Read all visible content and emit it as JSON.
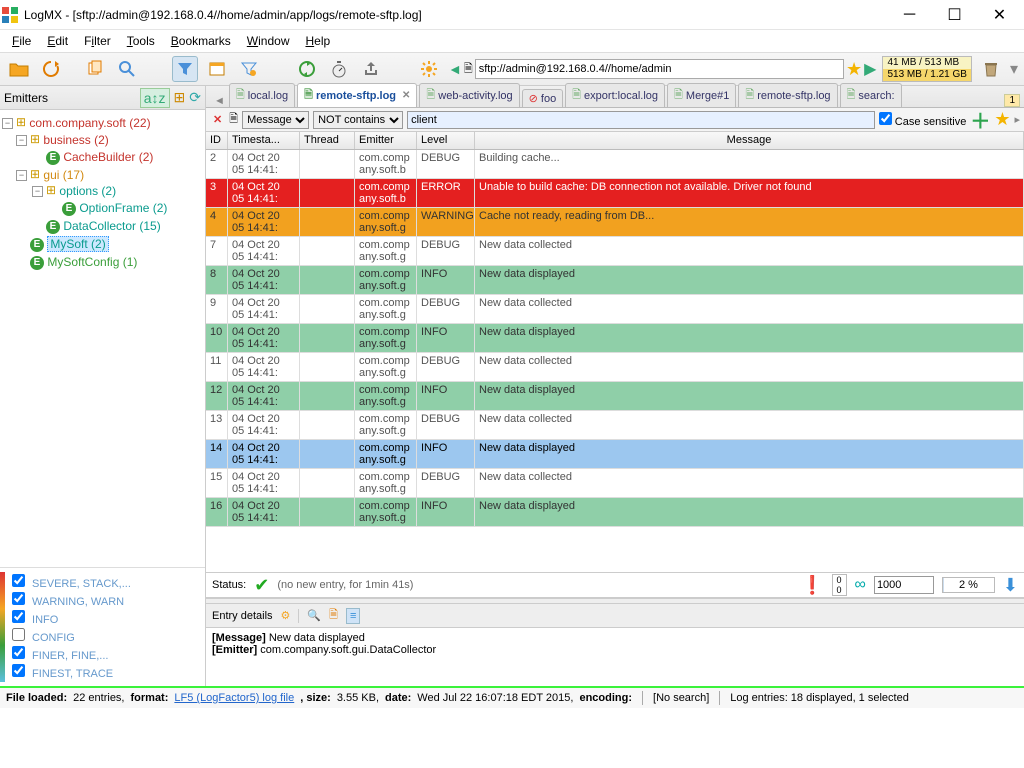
{
  "title": "LogMX - [sftp://admin@192.168.0.4//home/admin/app/logs/remote-sftp.log]",
  "menu": {
    "file": "File",
    "edit": "Edit",
    "filter": "Filter",
    "tools": "Tools",
    "bookmarks": "Bookmarks",
    "window": "Window",
    "help": "Help"
  },
  "addressbar": {
    "value": "sftp://admin@192.168.0.4//home/admin"
  },
  "memory": {
    "line1": "41 MB / 513 MB",
    "line2": "513 MB / 1.21 GB"
  },
  "emitters": {
    "title": "Emitters",
    "nodes": [
      {
        "label": "com.company.soft (22)",
        "color": "red",
        "depth": 0,
        "open": true,
        "pkg": true
      },
      {
        "label": "business (2)",
        "color": "red",
        "depth": 1,
        "open": true,
        "pkg": true
      },
      {
        "label": "CacheBuilder (2)",
        "color": "red",
        "depth": 2,
        "cls": "E"
      },
      {
        "label": "gui (17)",
        "color": "orange",
        "depth": 1,
        "open": true,
        "pkg": true
      },
      {
        "label": "options (2)",
        "color": "teal",
        "depth": 2,
        "open": true,
        "pkg": true
      },
      {
        "label": "OptionFrame (2)",
        "color": "teal",
        "depth": 3,
        "cls": "E"
      },
      {
        "label": "DataCollector (15)",
        "color": "teal",
        "depth": 2,
        "cls": "E"
      },
      {
        "label": "MySoft (2)",
        "color": "teal",
        "depth": 1,
        "cls": "E",
        "selected": true
      },
      {
        "label": "MySoftConfig (1)",
        "color": "green",
        "depth": 1,
        "cls": "E"
      }
    ]
  },
  "levelFilter": [
    {
      "label": "SEVERE, STACK,...",
      "checked": true
    },
    {
      "label": "WARNING, WARN",
      "checked": true
    },
    {
      "label": "INFO",
      "checked": true
    },
    {
      "label": "CONFIG",
      "checked": false
    },
    {
      "label": "FINER, FINE,...",
      "checked": true
    },
    {
      "label": "FINEST, TRACE",
      "checked": true
    }
  ],
  "tabs": [
    {
      "label": "local.log"
    },
    {
      "label": "remote-sftp.log",
      "active": true,
      "closable": true
    },
    {
      "label": "web-activity.log"
    },
    {
      "label": "foo",
      "blocked": true
    },
    {
      "label": "export:local.log"
    },
    {
      "label": "Merge#1"
    },
    {
      "label": "remote-sftp.log"
    },
    {
      "label": "search:"
    }
  ],
  "filter": {
    "field": "Message",
    "op": "NOT contains",
    "value": "client",
    "caseSensitive": "Case sensitive"
  },
  "columns": {
    "id": "ID",
    "ts": "Timesta...",
    "thr": "Thread",
    "em": "Emitter",
    "lvl": "Level",
    "msg": "Message"
  },
  "rows": [
    {
      "id": "2",
      "ts": "04 Oct 2005 14:41:",
      "em": "com.company.soft.b",
      "lvl": "DEBUG",
      "msg": "Building cache...",
      "style": "default"
    },
    {
      "id": "3",
      "ts": "04 Oct 2005 14:41:",
      "em": "com.company.soft.b",
      "lvl": "ERROR",
      "msg": "Unable to build cache: DB connection not available. Driver not found",
      "style": "error"
    },
    {
      "id": "4",
      "ts": "04 Oct 2005 14:41:",
      "em": "com.company.soft.g",
      "lvl": "WARNING",
      "msg": "Cache not ready, reading from DB...",
      "style": "warn"
    },
    {
      "id": "7",
      "ts": "04 Oct 2005 14:41:",
      "em": "com.company.soft.g",
      "lvl": "DEBUG",
      "msg": "New data collected",
      "style": "default"
    },
    {
      "id": "8",
      "ts": "04 Oct 2005 14:41:",
      "em": "com.company.soft.g",
      "lvl": "INFO",
      "msg": "New data displayed",
      "style": "debug-g"
    },
    {
      "id": "9",
      "ts": "04 Oct 2005 14:41:",
      "em": "com.company.soft.g",
      "lvl": "DEBUG",
      "msg": "New data collected",
      "style": "default"
    },
    {
      "id": "10",
      "ts": "04 Oct 2005 14:41:",
      "em": "com.company.soft.g",
      "lvl": "INFO",
      "msg": "New data displayed",
      "style": "debug-g"
    },
    {
      "id": "11",
      "ts": "04 Oct 2005 14:41:",
      "em": "com.company.soft.g",
      "lvl": "DEBUG",
      "msg": "New data collected",
      "style": "default"
    },
    {
      "id": "12",
      "ts": "04 Oct 2005 14:41:",
      "em": "com.company.soft.g",
      "lvl": "INFO",
      "msg": "New data displayed",
      "style": "debug-g"
    },
    {
      "id": "13",
      "ts": "04 Oct 2005 14:41:",
      "em": "com.company.soft.g",
      "lvl": "DEBUG",
      "msg": "New data collected",
      "style": "default"
    },
    {
      "id": "14",
      "ts": "04 Oct 2005 14:41:",
      "em": "com.company.soft.g",
      "lvl": "INFO",
      "msg": "New data displayed",
      "style": "selected"
    },
    {
      "id": "15",
      "ts": "04 Oct 2005 14:41:",
      "em": "com.company.soft.g",
      "lvl": "DEBUG",
      "msg": "New data collected",
      "style": "default"
    },
    {
      "id": "16",
      "ts": "04 Oct 2005 14:41:",
      "em": "com.company.soft.g",
      "lvl": "INFO",
      "msg": "New data displayed",
      "style": "debug-g"
    }
  ],
  "status": {
    "label": "Status:",
    "text": "(no new entry, for 1min 41s)",
    "counter1": "0",
    "counter2": "0",
    "limit": "1000",
    "percent": "2 %"
  },
  "details": {
    "title": "Entry details",
    "messageLabel": "[Message]",
    "messageValue": "New data displayed",
    "emitterLabel": "[Emitter]",
    "emitterValue": "com.company.soft.gui.DataCollector"
  },
  "footer": {
    "loaded_label": "File loaded:",
    "loaded_value": "22 entries,",
    "format_label": "format:",
    "format_link": "LF5 (LogFactor5) log file",
    "size_label": ", size:",
    "size_value": "3.55 KB,",
    "date_label": "date:",
    "date_value": "Wed Jul 22 16:07:18 EDT 2015,",
    "encoding_label": "encoding:",
    "search": "[No search]",
    "entries": "Log entries: 18 displayed, 1 selected"
  }
}
